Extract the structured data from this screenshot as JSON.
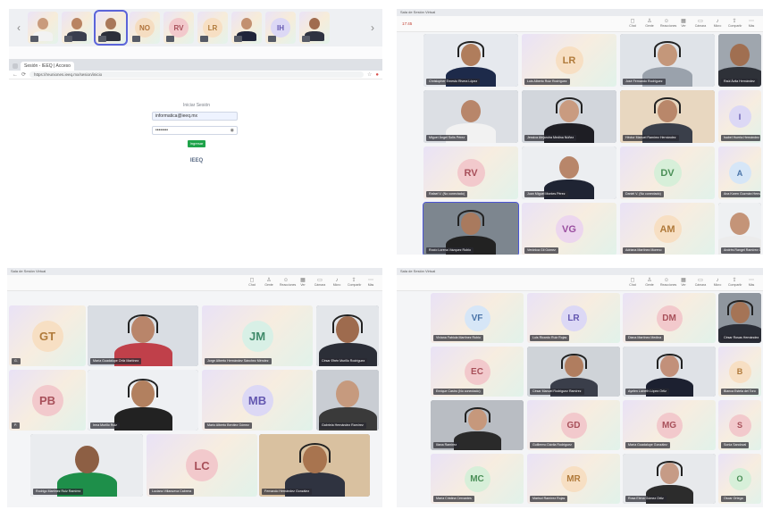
{
  "strip": {
    "left_arrow": "‹",
    "right_arrow": "›",
    "tiles": [
      {
        "type": "photo",
        "skin": "#c99b7c",
        "shirt": "#f2f2f2"
      },
      {
        "type": "photo",
        "skin": "#b98462",
        "shirt": "#3a3f4f"
      },
      {
        "type": "photo",
        "skin": "#a9785a",
        "shirt": "#2c2f3a",
        "selected": true
      },
      {
        "type": "avatar",
        "initials": "NO",
        "bg": "#f5ddc1",
        "fg": "#b0723a"
      },
      {
        "type": "avatar",
        "initials": "RV",
        "bg": "#f2c9cc",
        "fg": "#a8505a"
      },
      {
        "type": "avatar",
        "initials": "LR",
        "bg": "#f7dfc3",
        "fg": "#b07a3a"
      },
      {
        "type": "photo",
        "skin": "#c29070",
        "shirt": "#20253a"
      },
      {
        "type": "avatar",
        "initials": "IH",
        "bg": "#dcd8f5",
        "fg": "#6357b0"
      },
      {
        "type": "photo",
        "skin": "#a06c4f",
        "shirt": "#2f3340"
      }
    ]
  },
  "browser": {
    "tab_title": "Sesión - IEEQ | Acceso",
    "url": "https://reuniones.ieeq.mx/sesion/inicio",
    "login_title": "Iniciar Sesión",
    "email_value": "informatica@ieeq.mx",
    "password_value": "••••••••",
    "submit_label": "Ingresar",
    "logo_text": "IEEQ"
  },
  "toolbar": {
    "items": [
      "Chat",
      "Gente",
      "Reacciones",
      "Ver",
      "Cámara",
      "Micro",
      "Compartir",
      "Más"
    ],
    "icons": [
      "chat-icon",
      "people-icon",
      "reaction-icon",
      "view-icon",
      "camera-icon",
      "mic-icon",
      "share-icon",
      "more-icon"
    ]
  },
  "q2": {
    "topbar": "Sala de Sesión Virtual",
    "title": "17:45",
    "tiles": [
      {
        "type": "video",
        "name": "Christopher Ernesto Rivera López",
        "skin": "#b07d5c",
        "shirt": "#1d2a4a",
        "bg": "#e6e9ee",
        "headset": true
      },
      {
        "type": "avatar",
        "initials": "LR",
        "name": "Luis Alberto Ruiz Rodríguez",
        "bg": "#f7dfc3",
        "fg": "#b07a3a"
      },
      {
        "type": "video",
        "name": "José Fernando Rodríguez",
        "skin": "#c4977a",
        "shirt": "#9aa2ac",
        "bg": "#dfe3e8",
        "headset": true
      },
      {
        "type": "video",
        "name": "Raúl Ávila Hernández",
        "skin": "#a06f51",
        "shirt": "#2e3138",
        "bg": "#9fa6ae"
      },
      {
        "type": "video",
        "name": "Miguel Ángel Solís Pérez",
        "skin": "#b8866a",
        "shirt": "#f2f2f2",
        "bg": "#dcdfe4"
      },
      {
        "type": "video",
        "name": "Jessica Alejandra Medina Núñez",
        "skin": "#c99b80",
        "shirt": "#1e1e24",
        "bg": "#d2d6dc",
        "headset": true
      },
      {
        "type": "video",
        "name": "Héctor Manuel Ramírez Hernández",
        "skin": "#b9876a",
        "shirt": "#3a3f4a",
        "bg": "#e8d7c0",
        "headset": true
      },
      {
        "type": "avatar",
        "initials": "I",
        "name": "Isabel Huerta Hernández",
        "bg": "#dcd8f5",
        "fg": "#6357b0"
      },
      {
        "type": "avatar",
        "initials": "RV",
        "name": "Rafael V. (No conectado)",
        "bg": "#f2c9cc",
        "fg": "#a8505a"
      },
      {
        "type": "video",
        "name": "Juan Miguel Montes Pérez",
        "skin": "#b8866a",
        "shirt": "#1f2433",
        "bg": "#eceef1"
      },
      {
        "type": "avatar",
        "initials": "DV",
        "name": "Daniel V. (No conectado)",
        "bg": "#d7efd9",
        "fg": "#4a8f57"
      },
      {
        "type": "avatar",
        "initials": "A",
        "name": "Ana Karen Guzmán Hernández",
        "bg": "#d6e6f7",
        "fg": "#4a74a8"
      },
      {
        "type": "video",
        "name": "Rocío Lorena Vázquez Rubio",
        "skin": "#a97a5e",
        "shirt": "#222",
        "bg": "#7d868f",
        "headset": true,
        "selected": true
      },
      {
        "type": "avatar",
        "initials": "VG",
        "name": "Verónica Gil Gómez",
        "bg": "#ecd6ee",
        "fg": "#9a4fa0"
      },
      {
        "type": "avatar",
        "initials": "AM",
        "name": "Adriana Martínez Moreno",
        "bg": "#f7dfc3",
        "fg": "#b07a3a"
      },
      {
        "type": "video",
        "name": "Andrés Rangel Ramírez Guzmán",
        "skin": "#c49478",
        "shirt": "#ececec",
        "bg": "#eef0f2"
      }
    ]
  },
  "q3": {
    "topbar": "Sala de Sesión Virtual",
    "title": "",
    "tiles": [
      {
        "type": "avatar",
        "initials": "GT",
        "name": "G.",
        "bg": "#f7dfc3",
        "fg": "#b07a3a"
      },
      {
        "type": "video",
        "name": "María Guadalupe Ortiz Martínez",
        "skin": "#b9856a",
        "shirt": "#c0404a",
        "bg": "#d9dde3",
        "headset": true
      },
      {
        "type": "avatar",
        "initials": "JM",
        "name": "Jorge Alberto Hernández Sánchez Méndez",
        "bg": "#d8f0e6",
        "fg": "#3f8a6a"
      },
      {
        "type": "video",
        "name": "César Efrén Murillo Rodríguez",
        "skin": "#9e6b4e",
        "shirt": "#2b2e37",
        "bg": "#e3e6ea",
        "headset": true
      },
      {
        "type": "avatar",
        "initials": "PB",
        "name": "P.",
        "bg": "#f2c9cc",
        "fg": "#a8505a"
      },
      {
        "type": "video",
        "name": "Irma Murillo Ruiz",
        "skin": "#b2805f",
        "shirt": "#222",
        "bg": "#eef0f3",
        "headset": true
      },
      {
        "type": "avatar",
        "initials": "MB",
        "name": "Mario Alberto Benítez Gómez",
        "bg": "#dcd8f5",
        "fg": "#6357b0"
      },
      {
        "type": "video",
        "name": "Gabriela Hernández Ramírez",
        "skin": "#c69a7e",
        "shirt": "#3a3a3a",
        "bg": "#c9cdd3"
      },
      {
        "type": "video",
        "name": "Rodrigo Martínez Ruiz Ramírez",
        "skin": "#8d5f44",
        "shirt": "#1e8f4a",
        "bg": "#eaecef"
      },
      {
        "type": "avatar",
        "initials": "LC",
        "name": "Luciano Villanueva Cabrera",
        "bg": "#f2c9cc",
        "fg": "#a8505a"
      },
      {
        "type": "video",
        "name": "Fernando Hernández González",
        "skin": "#a8744f",
        "shirt": "#2f3340",
        "bg": "#d9c1a0",
        "headset": true
      }
    ]
  },
  "q4": {
    "topbar": "Sala de Sesión Virtual",
    "title": "",
    "tiles": [
      {
        "type": "avatar",
        "initials": "VF",
        "name": "Viviana Fabiola Martínez Rubio",
        "bg": "#d6e6f7",
        "fg": "#4a74a8"
      },
      {
        "type": "avatar",
        "initials": "LR",
        "name": "Luis Ricardo Ruiz Rojas",
        "bg": "#dcd8f5",
        "fg": "#6357b0"
      },
      {
        "type": "avatar",
        "initials": "DM",
        "name": "Diana Martínez Medina",
        "bg": "#f2c9cc",
        "fg": "#a8505a"
      },
      {
        "type": "video",
        "name": "César Rosas Hernández",
        "skin": "#a57456",
        "shirt": "#2a2d36",
        "bg": "#8f969e",
        "headset": true
      },
      {
        "type": "avatar",
        "initials": "EC",
        "name": "Enrique Castro (No conectado)",
        "bg": "#f2c9cc",
        "fg": "#a8505a"
      },
      {
        "type": "video",
        "name": "César Manuel Rodríguez Ramírez",
        "skin": "#b07d5f",
        "shirt": "#3a3e4a",
        "bg": "#cfd3d8",
        "headset": true
      },
      {
        "type": "video",
        "name": "Ayelen Lizbeth López Ortiz",
        "skin": "#c2907a",
        "shirt": "#1c2030",
        "bg": "#dfe2e7",
        "headset": true
      },
      {
        "type": "avatar",
        "initials": "B",
        "name": "Blanca Estela del Toro",
        "bg": "#f7dfc3",
        "fg": "#b07a3a"
      },
      {
        "type": "video",
        "name": "Iliana Ramírez",
        "skin": "#c6987c",
        "shirt": "#2a2a2a",
        "bg": "#b9bdc3",
        "headset": true
      },
      {
        "type": "avatar",
        "initials": "GD",
        "name": "Guillermo Dávila Rodríguez",
        "bg": "#f2c9cc",
        "fg": "#a8505a"
      },
      {
        "type": "avatar",
        "initials": "MG",
        "name": "María Guadalupe González",
        "bg": "#f2c9cc",
        "fg": "#a8505a"
      },
      {
        "type": "avatar",
        "initials": "S",
        "name": "Sonia Sandoval",
        "bg": "#f2c9cc",
        "fg": "#a8505a"
      },
      {
        "type": "avatar",
        "initials": "MC",
        "name": "María Cristina Cervantes",
        "bg": "#d7efd9",
        "fg": "#4a8f57"
      },
      {
        "type": "avatar",
        "initials": "MR",
        "name": "Marisol Ramírez Rojas",
        "bg": "#f7dfc3",
        "fg": "#b07a3a"
      },
      {
        "type": "video",
        "name": "Rosa Elena Gómez Ortiz",
        "skin": "#c69b86",
        "shirt": "#2c2c2c",
        "bg": "#e7e9ec",
        "headset": true
      },
      {
        "type": "avatar",
        "initials": "O",
        "name": "Oscar Ortega",
        "bg": "#d7efd9",
        "fg": "#4a8f57"
      }
    ]
  }
}
